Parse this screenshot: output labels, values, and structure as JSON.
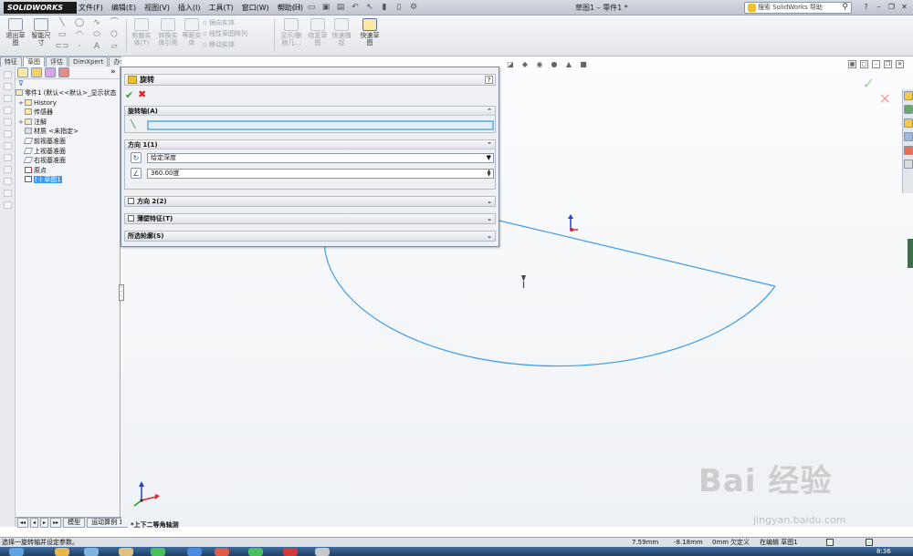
{
  "app": {
    "logo": "SOLIDWORKS",
    "doc_title": "草图1 – 零件1 *"
  },
  "menu": [
    "文件(F)",
    "编辑(E)",
    "视图(V)",
    "插入(I)",
    "工具(T)",
    "窗口(W)",
    "帮助(H)"
  ],
  "search": {
    "placeholder": "搜索 SolidWorks 帮助"
  },
  "ribbon": {
    "exit_sketch": "退出草\n图",
    "smart_dim": "智能尺\n寸",
    "trim": "剪裁实\n体(T)",
    "convert": "转换实\n体引用",
    "offset": "等距实\n体",
    "mirror": "镜向实体",
    "linear_pattern": "线性草图阵列",
    "move": "移动实体",
    "display_relations": "显示/删\n除几…",
    "repair": "修复草\n图",
    "quick_snap": "快速捕\n捉",
    "rapid_sketch": "快速草\n图"
  },
  "tabs": [
    "特征",
    "草图",
    "评估",
    "DimXpert",
    "办公室产品"
  ],
  "active_tab": 1,
  "tree": {
    "root": "零件1  (默认<<默认>_显示状态",
    "items": [
      {
        "label": "History",
        "expand": "+"
      },
      {
        "label": "传感器",
        "expand": ""
      },
      {
        "label": "注解",
        "expand": "+"
      },
      {
        "label": "材质 <未指定>",
        "expand": ""
      },
      {
        "label": "前视基准面",
        "expand": ""
      },
      {
        "label": "上视基准面",
        "expand": ""
      },
      {
        "label": "右视基准面",
        "expand": ""
      },
      {
        "label": "原点",
        "expand": ""
      },
      {
        "label": "(-) 草图1",
        "expand": "",
        "selected": true
      }
    ],
    "bottom_tabs": [
      "模型",
      "运动算例 1"
    ]
  },
  "pm": {
    "title": "旋转",
    "help": "?",
    "axis_group": "旋转轴(A)",
    "dir1_group": "方向 1(1)",
    "end_condition": "给定深度",
    "angle": "360.00度",
    "dir2_group": "方向 2(2)",
    "thin_group": "薄壁特征(T)",
    "contours_group": "所选轮廓(S)"
  },
  "view": {
    "orientation": "*上下二等角轴测"
  },
  "watermark": {
    "big": "Bai 经验",
    "small": "jingyan.baidu.com"
  },
  "status": {
    "message": "选择一旋转轴并设定参数。",
    "x": "7.59mm",
    "y": "-8.18mm",
    "z": "0mm",
    "state": "欠定义",
    "editing": "在编辑 草图1"
  },
  "clock": "8:36",
  "colors": {
    "sketch": "#3f9be8",
    "selected": "#3399ff",
    "ok": "#2ea02e",
    "cancel": "#dd2222"
  }
}
